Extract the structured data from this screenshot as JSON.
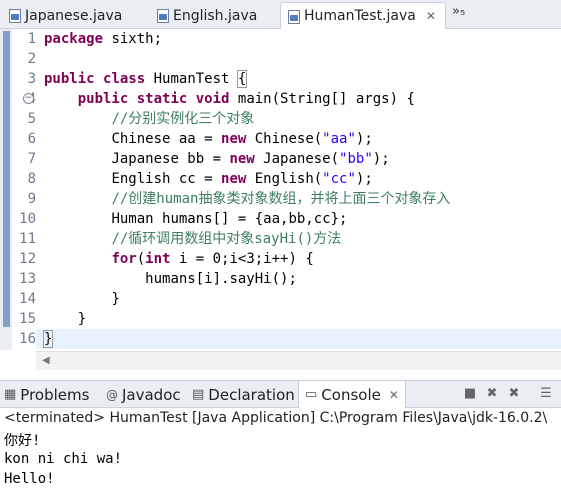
{
  "editor_tabs": [
    {
      "label": "Japanese.java",
      "active": false
    },
    {
      "label": "English.java",
      "active": false
    },
    {
      "label": "HumanTest.java",
      "active": true,
      "close": "✕"
    }
  ],
  "tab_overflow": "»₅",
  "line_numbers": [
    "1",
    "2",
    "3",
    "4",
    "5",
    "6",
    "7",
    "8",
    "9",
    "10",
    "11",
    "12",
    "13",
    "14",
    "15",
    "16"
  ],
  "code": {
    "l1_kw": "package",
    "l1_rest": " sixth;",
    "l3_kw1": "public",
    "l3_kw2": "class",
    "l3_rest": " HumanTest ",
    "l3_brace": "{",
    "l4_kw1": "public",
    "l4_kw2": "static",
    "l4_kw3": "void",
    "l4_rest": " main(String[] args) {",
    "l5_cmt": "//分别实例化三个对象",
    "l6_a": "Chinese aa = ",
    "l6_kw": "new",
    "l6_b": " Chinese(",
    "l6_str": "\"aa\"",
    "l6_c": ");",
    "l7_a": "Japanese bb = ",
    "l7_kw": "new",
    "l7_b": " Japanese(",
    "l7_str": "\"bb\"",
    "l7_c": ");",
    "l8_a": "English cc = ",
    "l8_kw": "new",
    "l8_b": " English(",
    "l8_str": "\"cc\"",
    "l8_c": ");",
    "l9_cmt": "//创建human抽象类对象数组，并将上面三个对象存入",
    "l10": "Human humans[] = {aa,bb,cc};",
    "l11_cmt": "//循环调用数组中对象sayHi()方法",
    "l12_kw1": "for",
    "l12_a": "(",
    "l12_kw2": "int",
    "l12_b": " i = 0;i<3;i++) {",
    "l13": "humans[i].sayHi();",
    "l14": "}",
    "l15": "}",
    "l16": "}"
  },
  "view_tabs": [
    {
      "label": "Problems",
      "icon": "problems-icon"
    },
    {
      "label": "Javadoc",
      "icon": "javadoc-icon"
    },
    {
      "label": "Declaration",
      "icon": "declaration-icon"
    },
    {
      "label": "Console",
      "icon": "console-icon",
      "active": true,
      "close": "✕"
    }
  ],
  "console": {
    "status": "<terminated> HumanTest [Java Application] C:\\Program Files\\Java\\jdk-16.0.2\\",
    "output": [
      "你好!",
      "kon ni chi wa!",
      "Hello!"
    ]
  }
}
